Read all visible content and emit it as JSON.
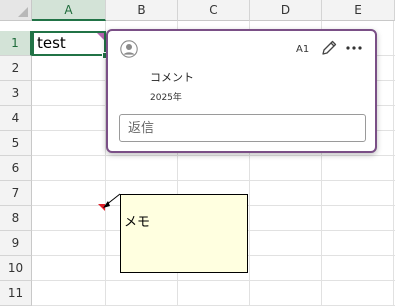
{
  "columns": [
    "A",
    "B",
    "C",
    "D",
    "E"
  ],
  "rows": [
    "1",
    "2",
    "3",
    "4",
    "5",
    "6",
    "7",
    "8",
    "9",
    "10",
    "11"
  ],
  "selected_cell": {
    "ref": "A1",
    "value": "test"
  },
  "comment_card": {
    "cell_ref": "A1",
    "text": "コメント",
    "date": "2025年",
    "reply_placeholder": "返信",
    "icons": {
      "avatar": "user-avatar-icon",
      "edit": "pencil-icon",
      "more": "more-options-icon"
    },
    "border_color": "#7a4f86"
  },
  "note": {
    "text": "メモ",
    "background": "#ffffe0"
  },
  "colors": {
    "selection": "#217346",
    "comment_indicator": "#b565b0",
    "note_indicator": "#e0202a"
  }
}
